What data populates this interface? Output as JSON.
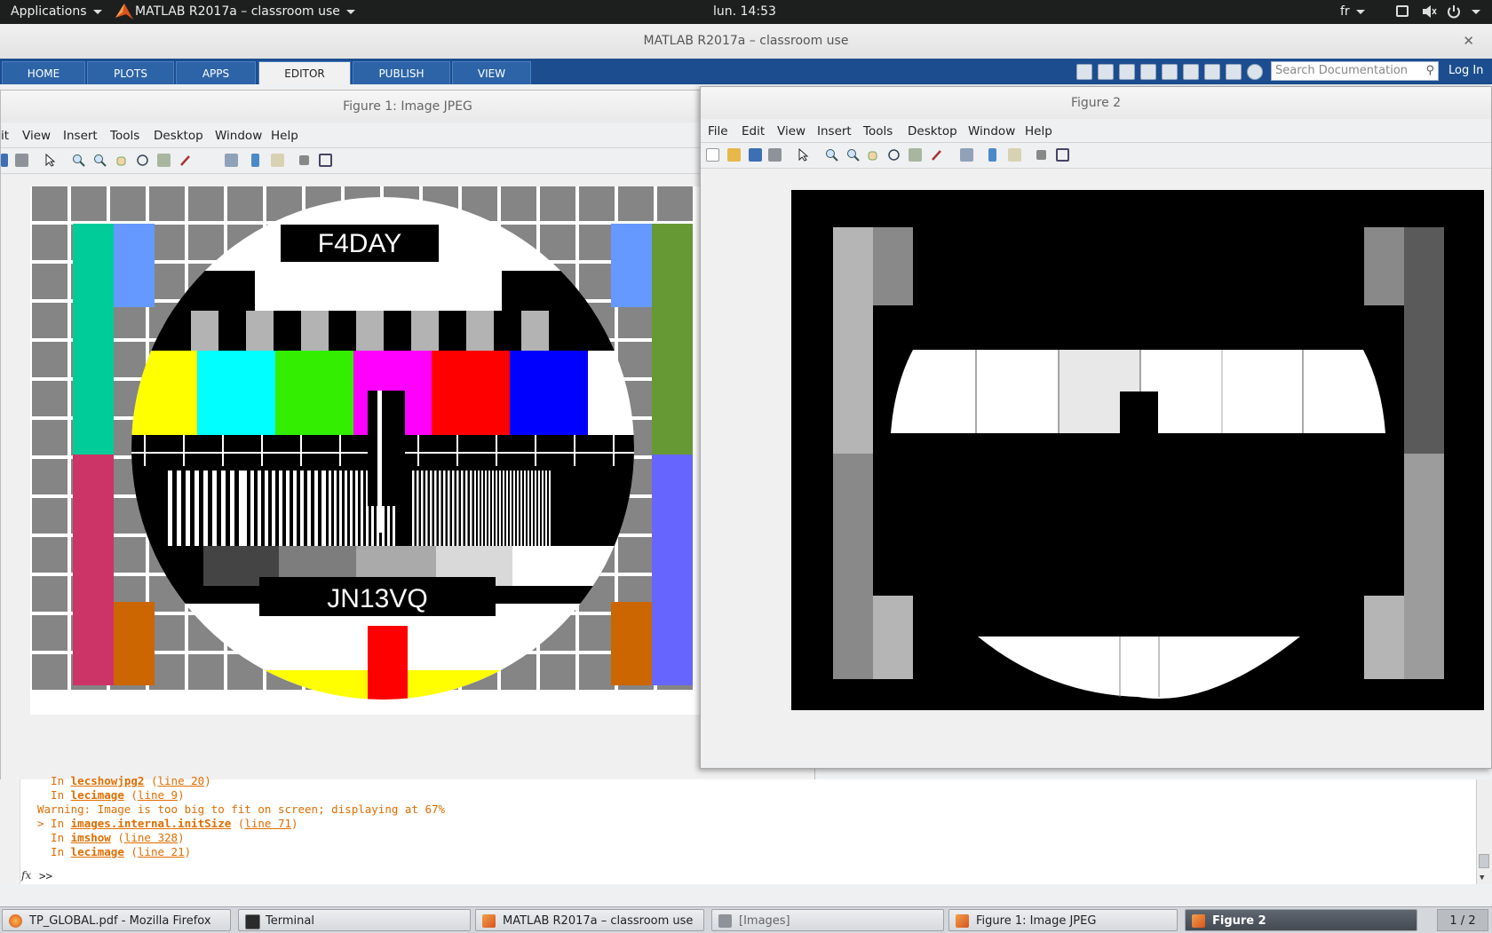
{
  "topbar": {
    "applications": "Applications",
    "window_title": "MATLAB R2017a – classroom use",
    "clock": "lun. 14:53",
    "language": "fr"
  },
  "matlab": {
    "title": "MATLAB R2017a – classroom use",
    "tabs": [
      "HOME",
      "PLOTS",
      "APPS",
      "EDITOR",
      "PUBLISH",
      "VIEW"
    ],
    "active_tab": "EDITOR",
    "search_placeholder": "Search Documentation",
    "login": "Log In"
  },
  "figure1": {
    "title": "Figure 1: Image JPEG",
    "menu": [
      "it",
      "View",
      "Insert",
      "Tools",
      "Desktop",
      "Window",
      "Help"
    ],
    "test_card": {
      "callsign": "F4DAY",
      "locator": "JN13VQ",
      "color_bars": [
        "#ffff00",
        "#00ffff",
        "#33ee00",
        "#ff00ff",
        "#ff0000",
        "#0000ff"
      ],
      "gray_steps": [
        "#000000",
        "#444444",
        "#7d7d7d",
        "#aaaaaa",
        "#d9d9d9",
        "#ffffff"
      ]
    }
  },
  "figure2": {
    "title": "Figure 2",
    "menu": [
      "File",
      "Edit",
      "View",
      "Insert",
      "Tools",
      "Desktop",
      "Window",
      "Help"
    ]
  },
  "command_window": {
    "lines": [
      {
        "prefix": "  In ",
        "link": "lecshowjpg2",
        "rest_prefix": " (",
        "line_link": "line 20",
        "suffix": ")"
      },
      {
        "prefix": "  In ",
        "link": "lecimage",
        "rest_prefix": " (",
        "line_link": "line 9",
        "suffix": ")"
      },
      {
        "text": "Warning: Image is too big to fit on screen; displaying at 67%"
      },
      {
        "prefix": "> In ",
        "link": "images.internal.initSize",
        "rest_prefix": " (",
        "line_link": "line 71",
        "suffix": ")"
      },
      {
        "prefix": "  In ",
        "link": "imshow",
        "rest_prefix": " (",
        "line_link": "line 328",
        "suffix": ")"
      },
      {
        "prefix": "  In ",
        "link": "lecimage",
        "rest_prefix": " (",
        "line_link": "line 21",
        "suffix": ")"
      }
    ],
    "prompt": ">>",
    "fx": "fx"
  },
  "taskbar": {
    "items": [
      "TP_GLOBAL.pdf - Mozilla Firefox",
      "Terminal",
      "MATLAB R2017a – classroom use",
      "[Images]",
      "Figure 1: Image JPEG",
      "Figure 2"
    ],
    "active_item": "Figure 2",
    "workspace": "1 / 2"
  }
}
